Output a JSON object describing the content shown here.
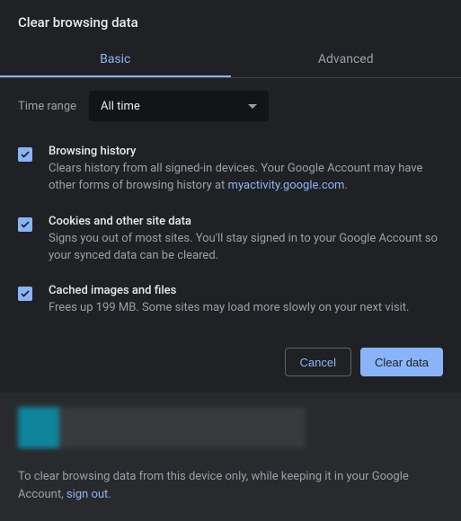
{
  "dialog": {
    "title": "Clear browsing data"
  },
  "tabs": {
    "basic": "Basic",
    "advanced": "Advanced"
  },
  "timerange": {
    "label": "Time range",
    "value": "All time"
  },
  "options": {
    "browsing": {
      "title": "Browsing history",
      "desc_pre": "Clears history from all signed-in devices. Your Google Account may have other forms of browsing history at ",
      "link": "myactivity.google.com",
      "desc_post": "."
    },
    "cookies": {
      "title": "Cookies and other site data",
      "desc": "Signs you out of most sites. You'll stay signed in to your Google Account so your synced data can be cleared."
    },
    "cache": {
      "title": "Cached images and files",
      "desc": "Frees up 199 MB. Some sites may load more slowly on your next visit."
    }
  },
  "buttons": {
    "cancel": "Cancel",
    "clear": "Clear data"
  },
  "footer": {
    "text_pre": "To clear browsing data from this device only, while keeping it in your Google Account, ",
    "signout": "sign out",
    "text_post": "."
  }
}
